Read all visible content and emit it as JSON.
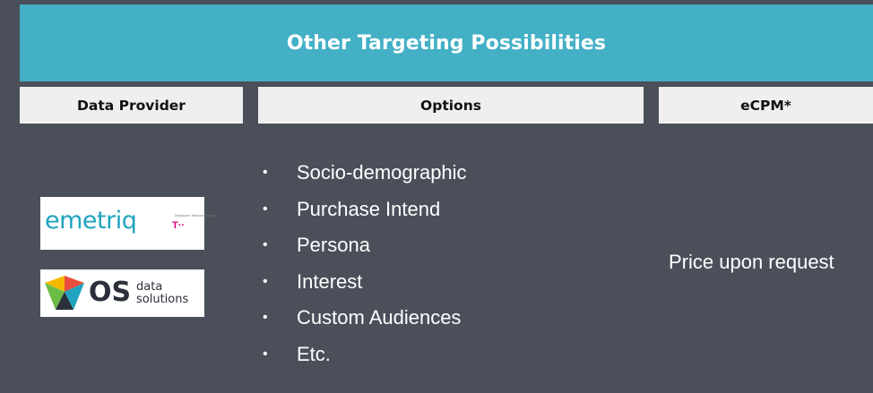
{
  "title": "Other Targeting Possibilities",
  "headers": {
    "provider": "Data Provider",
    "options": "Options",
    "ecpm": "eCPM*"
  },
  "options": [
    "Socio-demographic",
    "Purchase Intend",
    "Persona",
    "Interest",
    "Custom Audiences",
    "Etc."
  ],
  "bullet": "•",
  "price": "Price upon request",
  "logos": {
    "emetriq": {
      "name": "emetriq",
      "tagline": "Deutsche Telekom Gruppe",
      "mark": "T··"
    },
    "os": {
      "name": "OS",
      "sub_line1": "data",
      "sub_line2": "solutions"
    }
  },
  "colors": {
    "background": "#4a4f5a",
    "title_bar": "#43b0c6",
    "header_cell": "#efefef",
    "emetriq_teal": "#1fa3bf",
    "telekom_magenta": "#e20074"
  }
}
